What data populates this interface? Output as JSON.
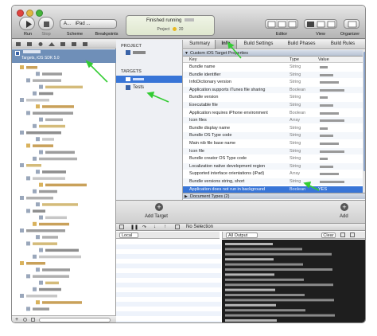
{
  "toolbar": {
    "run_label": "Run",
    "stop_label": "Stop",
    "scheme_label": "Scheme",
    "breakpoints_label": "Breakpoints",
    "scheme_value": "A...",
    "device_value": "iPad ...",
    "status_title": "Finished running",
    "status_project": "Project",
    "status_count": "20",
    "editor_label": "Editor",
    "view_label": "View",
    "organizer_label": "Organizer"
  },
  "sidebar": {
    "target_line": "Targets, iOS SDK 5.0"
  },
  "project_pane": {
    "project_header": "PROJECT",
    "targets_header": "TARGETS",
    "tests_label": "Tests",
    "add_target_label": "Add Target"
  },
  "tabs": [
    "Summary",
    "Info",
    "Build Settings",
    "Build Phases",
    "Build Rules"
  ],
  "plist": {
    "section_title": "Custom iOS Target Properties",
    "col_key": "Key",
    "col_type": "Type",
    "col_value": "Value",
    "rows": [
      {
        "key": "Bundle name",
        "type": "String"
      },
      {
        "key": "Bundle identifier",
        "type": "String"
      },
      {
        "key": "InfoDictionary version",
        "type": "String"
      },
      {
        "key": "Application supports iTunes file sharing",
        "type": "Boolean"
      },
      {
        "key": "Bundle version",
        "type": "String"
      },
      {
        "key": "Executable file",
        "type": "String"
      },
      {
        "key": "Application requires iPhone environment",
        "type": "Boolean"
      },
      {
        "key": "Icon files",
        "type": "Array"
      },
      {
        "key": "Bundle display name",
        "type": "String"
      },
      {
        "key": "Bundle OS Type code",
        "type": "String"
      },
      {
        "key": "Main nib file base name",
        "type": "String"
      },
      {
        "key": "Icon file",
        "type": "String"
      },
      {
        "key": "Bundle creator OS Type code",
        "type": "String"
      },
      {
        "key": "Localization native development region",
        "type": "String"
      },
      {
        "key": "Supported interface orientations (iPad)",
        "type": "Array"
      },
      {
        "key": "Bundle versions string, short",
        "type": "String"
      },
      {
        "key": "Application does not run in background",
        "type": "Boolean",
        "value": "YES"
      }
    ],
    "doc_types": "Document Types (2)",
    "add_label": "Add"
  },
  "debug": {
    "local_label": "Local",
    "no_selection": "No Selection",
    "all_output": "All Output",
    "clear_label": "Clear"
  },
  "colors": {
    "selection": "#3875d7",
    "arrow": "#33cc33",
    "console_bg": "#1e1e1e"
  }
}
